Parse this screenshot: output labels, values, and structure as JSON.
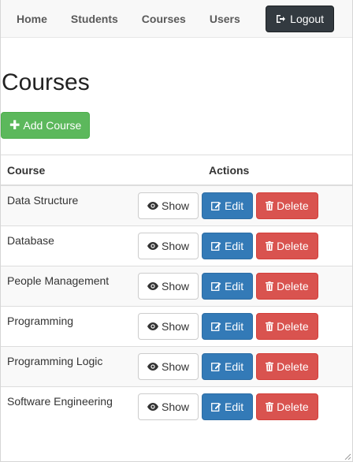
{
  "nav": {
    "links": [
      "Home",
      "Students",
      "Courses",
      "Users"
    ],
    "logout_label": "Logout"
  },
  "page": {
    "title": "Courses",
    "add_label": "Add Course"
  },
  "table": {
    "headers": {
      "course": "Course",
      "actions": "Actions"
    },
    "rows": [
      {
        "name": "Data Structure"
      },
      {
        "name": "Database"
      },
      {
        "name": "People Management"
      },
      {
        "name": "Programming"
      },
      {
        "name": "Programming Logic"
      },
      {
        "name": "Software Engineering"
      }
    ],
    "show_label": "Show",
    "edit_label": "Edit",
    "delete_label": "Delete"
  },
  "colors": {
    "success": "#5cb85c",
    "primary": "#337ab7",
    "danger": "#d9534f",
    "dark": "#333a40"
  },
  "icons": {
    "logout": "sign-out-icon",
    "add": "plus-icon",
    "show": "eye-icon",
    "edit": "pencil-square-icon",
    "delete": "trash-icon"
  }
}
